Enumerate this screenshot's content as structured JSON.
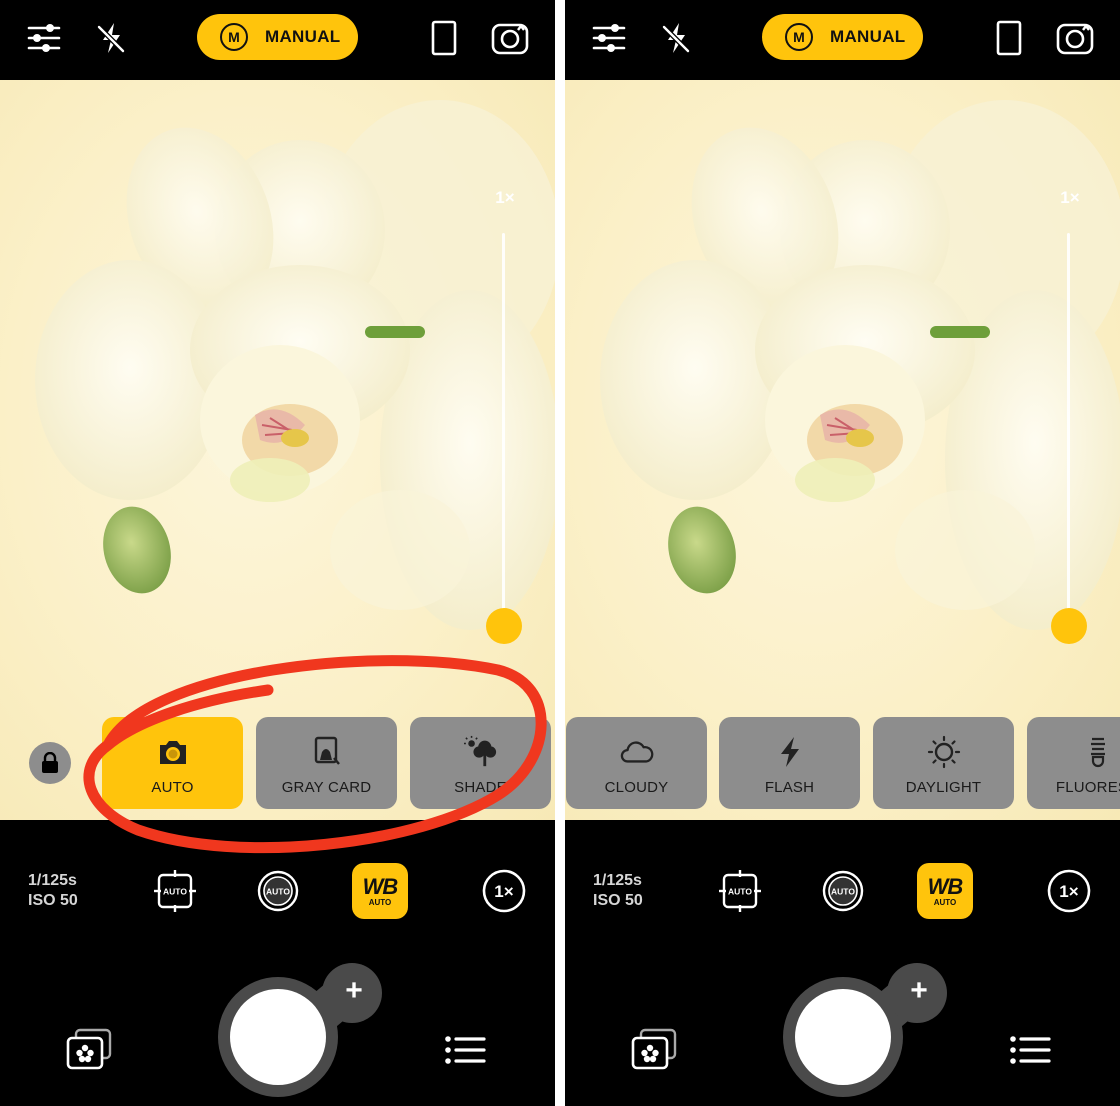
{
  "colors": {
    "accent": "#ffc40c",
    "inactive_preset": "#8d8d8d",
    "annotation": "#f0371e",
    "bar": "#000000"
  },
  "screens": [
    {
      "top_bar": {
        "mode_badge": "M",
        "mode_label": "MANUAL",
        "icons": [
          "sliders-icon",
          "flash-off-icon",
          "aspect-ratio-icon",
          "flip-camera-icon"
        ]
      },
      "zoom_slider": {
        "label": "1×",
        "level": 0
      },
      "wb_presets": [
        {
          "label": "AUTO",
          "icon": "camera-icon",
          "selected": true
        },
        {
          "label": "GRAY CARD",
          "icon": "gray-card-icon",
          "selected": false
        },
        {
          "label": "SHADE",
          "icon": "tree-shade-icon",
          "selected": false
        }
      ],
      "annotation": "red hand-drawn circle around AUTO / GRAY CARD / SHADE",
      "readout": {
        "shutter": "1/125s",
        "iso": "ISO 50"
      },
      "controls": {
        "focus": "AUTO",
        "exposure": "AUTO",
        "wb_big": "WB",
        "wb_small": "AUTO",
        "zoom": "1×"
      },
      "shutter_plus": "+"
    },
    {
      "top_bar": {
        "mode_badge": "M",
        "mode_label": "MANUAL",
        "icons": [
          "sliders-icon",
          "flash-off-icon",
          "aspect-ratio-icon",
          "flip-camera-icon"
        ]
      },
      "zoom_slider": {
        "label": "1×",
        "level": 0
      },
      "wb_presets": [
        {
          "label": "CLOUDY",
          "icon": "cloud-icon",
          "selected": false
        },
        {
          "label": "FLASH",
          "icon": "lightning-icon",
          "selected": false
        },
        {
          "label": "DAYLIGHT",
          "icon": "sun-icon",
          "selected": false
        },
        {
          "label": "FLUORESC",
          "icon": "fluorescent-bulb-icon",
          "selected": false
        }
      ],
      "readout": {
        "shutter": "1/125s",
        "iso": "ISO 50"
      },
      "controls": {
        "focus": "AUTO",
        "exposure": "AUTO",
        "wb_big": "WB",
        "wb_small": "AUTO",
        "zoom": "1×"
      },
      "shutter_plus": "+"
    }
  ]
}
